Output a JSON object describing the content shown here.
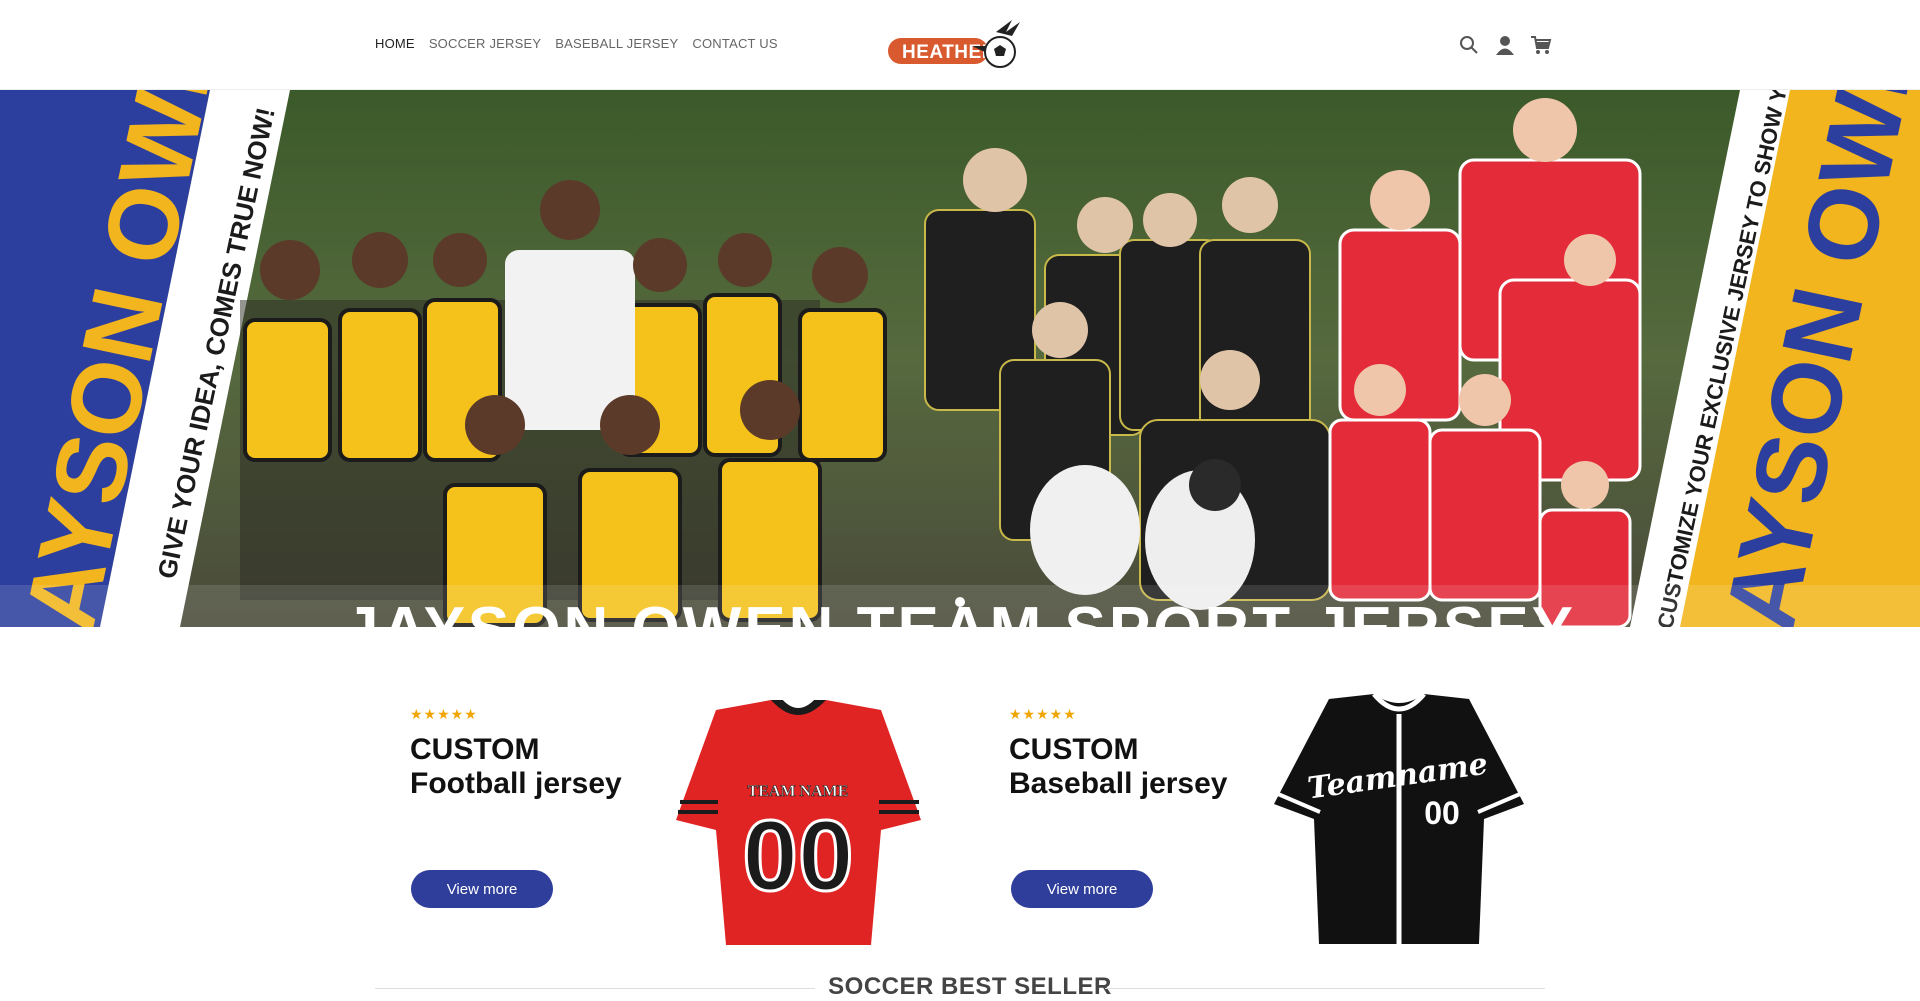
{
  "nav": {
    "items": [
      {
        "label": "HOME",
        "active": true
      },
      {
        "label": "SOCCER JERSEY",
        "active": false
      },
      {
        "label": "BASEBALL JERSEY",
        "active": false
      },
      {
        "label": "CONTACT US",
        "active": false
      }
    ]
  },
  "logo": {
    "text": "HEATHER"
  },
  "header_icons": [
    "search-icon",
    "account-icon",
    "cart-icon"
  ],
  "hero": {
    "left_banner_big": "JAYSON OWEN",
    "left_banner_slogan": "GIVE YOUR IDEA, COMES TRUE NOW!",
    "right_banner_big": "JAYSON OWEN",
    "right_banner_slogan": "CUSTOMIZE YOUR EXCLUSIVE JERSEY TO SHOW YOUR PERSONALITY",
    "title": "JAYSON OWEN TEAM SPORT JERSEY",
    "colors": {
      "banner_blue": "#2d3f9e",
      "banner_yellow": "#f2b51d",
      "team_yellow": "#f4c21a",
      "team_red": "#e32b3a"
    }
  },
  "promos": [
    {
      "stars": "★★★★★",
      "title_line1": "CUSTOM",
      "title_line2": "Football jersey",
      "button": "View more",
      "jersey_text_name": "TEAM NAME",
      "jersey_number": "00"
    },
    {
      "stars": "★★★★★",
      "title_line1": "CUSTOM",
      "title_line2": "Baseball jersey",
      "button": "View more",
      "jersey_text_name": "Teamname",
      "jersey_number": "00"
    }
  ],
  "section": {
    "title": "SOCCER BEST SELLER"
  },
  "colors": {
    "button_blue": "#2e3e9a",
    "star": "#f0a500",
    "logo_orange": "#d85a2e"
  }
}
